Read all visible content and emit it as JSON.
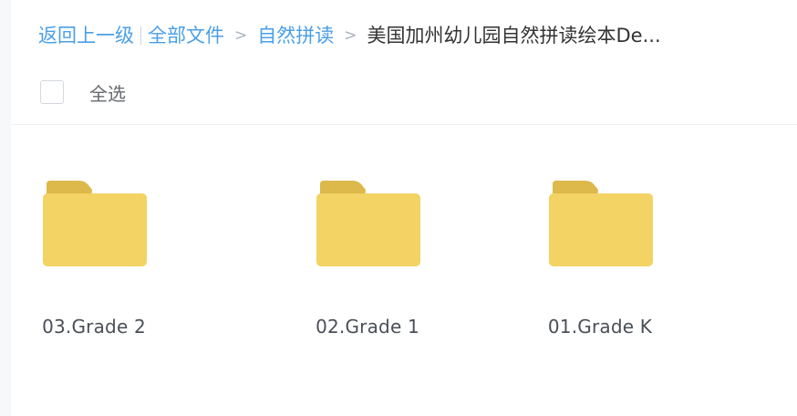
{
  "breadcrumb": {
    "back": "返回上一级",
    "all_files": "全部文件",
    "separator": ">",
    "level1": "自然拼读",
    "current": "美国加州幼儿园自然拼读绘本De..."
  },
  "toolbar": {
    "select_all_label": "全选"
  },
  "folders": [
    {
      "name": "03.Grade 2",
      "icon": "folder-icon"
    },
    {
      "name": "02.Grade 1",
      "icon": "folder-icon"
    },
    {
      "name": "01.Grade K",
      "icon": "folder-icon"
    }
  ],
  "colors": {
    "link": "#4a9fe8",
    "folder_body": "#f2d363",
    "folder_tab": "#dcb94a"
  }
}
